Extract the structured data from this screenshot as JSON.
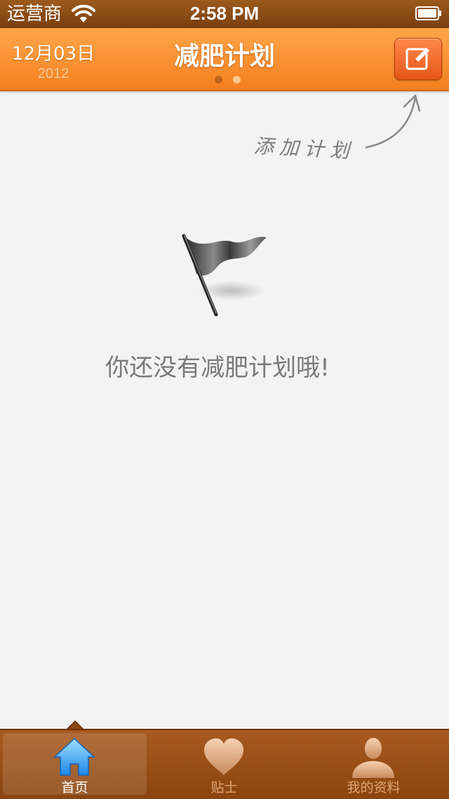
{
  "status_bar": {
    "carrier": "运营商",
    "time": "2:58 PM",
    "wifi_icon": "wifi-icon",
    "battery_icon": "battery-icon"
  },
  "header": {
    "date": "12月03日",
    "year": "2012",
    "title": "减肥计划",
    "page_count": 2,
    "current_page": 1,
    "compose_icon": "compose-icon",
    "accent_color": "#f47f1e"
  },
  "main": {
    "hint_label": "添加计划",
    "empty_message": "你还没有减肥计划哦!",
    "empty_icon": "flag-icon"
  },
  "tab_bar": {
    "items": [
      {
        "label": "首页",
        "icon": "home-icon",
        "selected": true
      },
      {
        "label": "贴士",
        "icon": "heart-icon",
        "selected": false
      },
      {
        "label": "我的资料",
        "icon": "person-icon",
        "selected": false
      }
    ]
  }
}
